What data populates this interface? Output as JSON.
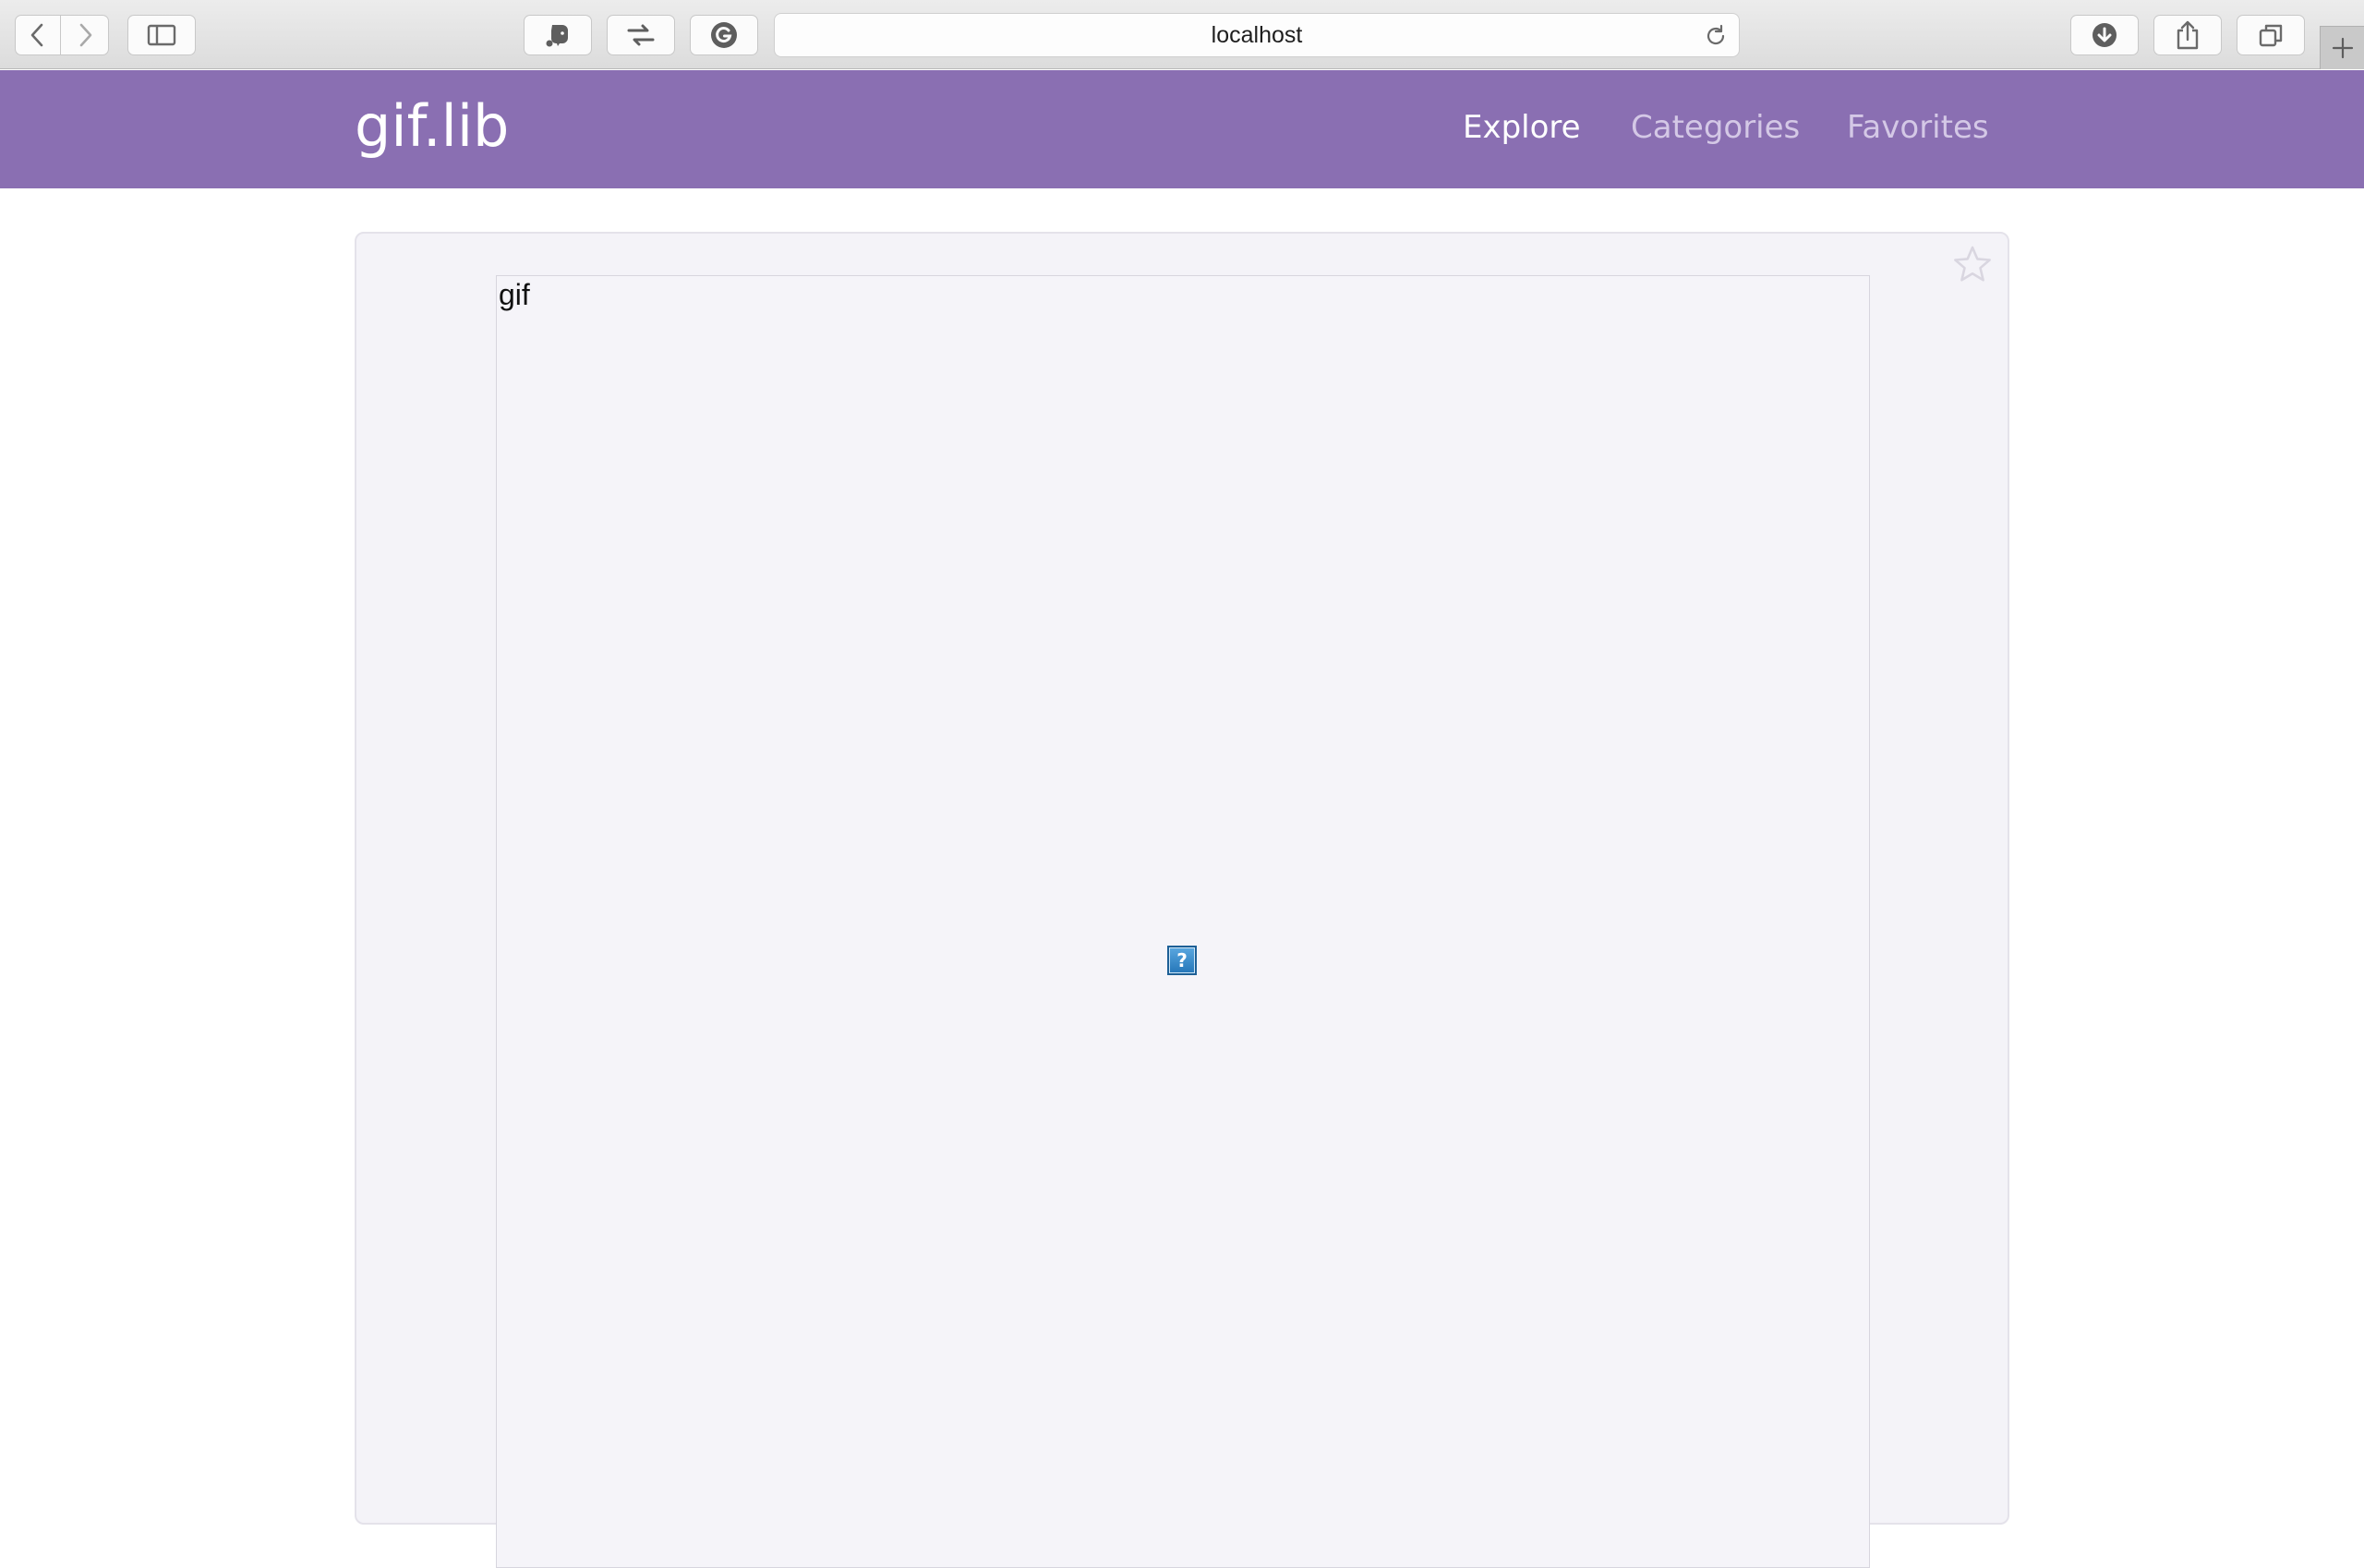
{
  "browser": {
    "url": "localhost",
    "icons": {
      "back": "chevron-left-icon",
      "forward": "chevron-right-icon",
      "sidebar": "sidebar-icon",
      "evernote": "evernote-icon",
      "transfer": "swap-arrows-icon",
      "grammarly": "grammarly-icon",
      "reload": "reload-icon",
      "downloads": "download-icon",
      "share": "share-icon",
      "tabs": "tabs-icon",
      "new_tab": "plus-icon"
    }
  },
  "header": {
    "brand": "gif.lib",
    "nav": [
      {
        "label": "Explore",
        "active": true
      },
      {
        "label": "Categories",
        "active": false
      },
      {
        "label": "Favorites",
        "active": false
      }
    ],
    "colors": {
      "background": "#8a6fb2",
      "active_link": "#ffffff",
      "inactive_link": "#d4c8e6"
    }
  },
  "main": {
    "gif_alt_text": "gif",
    "broken_image_glyph": "?",
    "favorite_icon": "star-outline-icon"
  }
}
